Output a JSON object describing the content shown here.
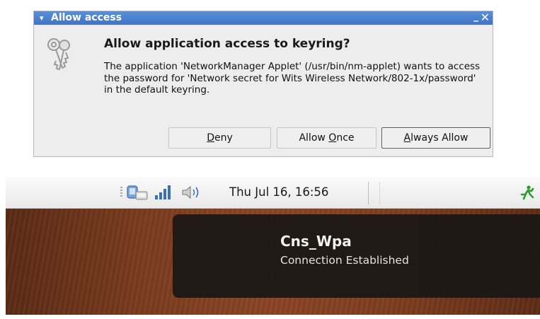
{
  "dialog": {
    "title": "Allow access",
    "heading": "Allow application access to keyring?",
    "message": "The application 'NetworkManager Applet' (/usr/bin/nm-applet) wants to access the password for 'Network secret for Wits Wireless Network/802-1x/password' in the default keyring.",
    "buttons": {
      "deny_mnemonic": "D",
      "deny_rest": "eny",
      "once_prefix": "Allow ",
      "once_mnemonic": "O",
      "once_rest": "nce",
      "always_mnemonic": "A",
      "always_rest": "lways Allow"
    },
    "minimize_glyph": "_",
    "close_glyph": "✕",
    "menu_glyph": "▾"
  },
  "panel": {
    "clock": "Thu Jul 16, 16:56",
    "icons": [
      "network-manager-icon",
      "wireless-signal-icon",
      "volume-icon",
      "running-man-icon"
    ]
  },
  "notification": {
    "title": "Cns_Wpa",
    "body": "Connection Established"
  },
  "colors": {
    "titlebar": "#4a80cf",
    "dialog_bg": "#ededed",
    "notify_bg": "#1c1816",
    "desktop": "#7a3b1d"
  }
}
